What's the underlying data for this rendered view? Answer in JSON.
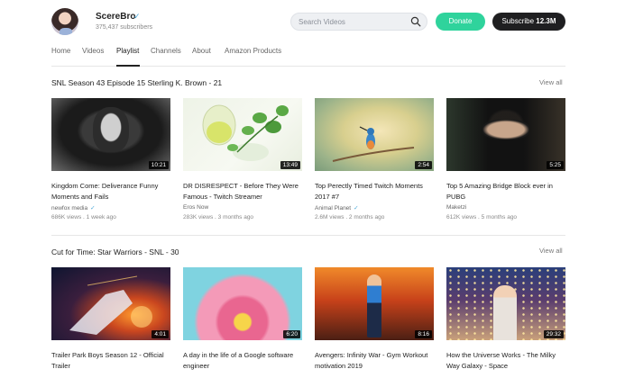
{
  "channel": {
    "name": "ScereBro",
    "subscribers": "375,437 subscribers",
    "verified_icon": "check-icon"
  },
  "search": {
    "placeholder": "Search Videos",
    "value": ""
  },
  "buttons": {
    "donate": "Donate",
    "subscribe_label": "Subscribe",
    "subscribe_count": "12.3M"
  },
  "nav": {
    "items": [
      "Home",
      "Videos",
      "Playlist",
      "Channels",
      "About",
      "Amazon Products"
    ],
    "active": "Playlist"
  },
  "sections": [
    {
      "title": "SNL Season 43 Episode 15 Sterling K. Brown - 21",
      "view_all": "View all",
      "videos": [
        {
          "title": "Kingdom Come: Deliverance Funny Moments and Fails",
          "channel": "newfox media",
          "verified": true,
          "meta": "686K views . 1 week ago",
          "duration": "10:21"
        },
        {
          "title": "DR DISRESPECT - Before They Were Famous - Twitch Streamer",
          "channel": "Eros Now",
          "verified": false,
          "meta": "283K views . 3 months ago",
          "duration": "13:49"
        },
        {
          "title": "Top Perectly Timed Twitch Moments 2017 #7",
          "channel": "Animal Planet",
          "verified": true,
          "meta": "2.6M views . 2 months ago",
          "duration": "2:54"
        },
        {
          "title": "Top 5 Amazing Bridge Block ever in PUBG",
          "channel": "Maketzi",
          "verified": false,
          "meta": "612K views . 5 months ago",
          "duration": "5:25"
        }
      ]
    },
    {
      "title": "Cut for Time: Star Warriors - SNL - 30",
      "view_all": "View all",
      "videos": [
        {
          "title": "Trailer Park Boys Season 12 - Official Trailer",
          "duration": "4:01"
        },
        {
          "title": "A day in the life of a Google software engineer",
          "duration": "6:20"
        },
        {
          "title": "Avengers: Infinity War - Gym Workout motivation 2019",
          "duration": "8:16"
        },
        {
          "title": "How the Universe Works - The Milky Way Galaxy - Space",
          "duration": "29:32"
        }
      ]
    }
  ],
  "colors": {
    "donate": "#2fd39c",
    "subscribe": "#1f1f21",
    "verified": "#4aa8d8"
  }
}
